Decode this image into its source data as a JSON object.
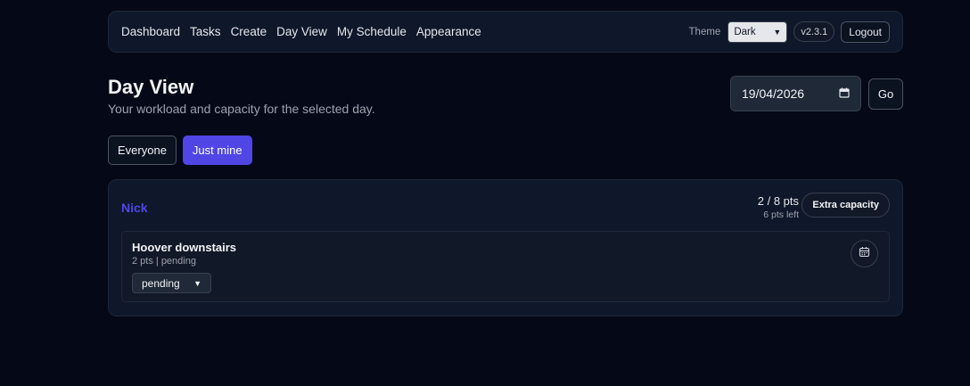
{
  "nav": {
    "links": [
      "Dashboard",
      "Tasks",
      "Create",
      "Day View",
      "My Schedule",
      "Appearance"
    ],
    "theme_label": "Theme",
    "theme_value": "Dark",
    "version": "v2.3.1",
    "logout": "Logout"
  },
  "header": {
    "title": "Day View",
    "subtitle": "Your workload and capacity for the selected day.",
    "date_value": "19/04/2026",
    "go_label": "Go"
  },
  "filters": {
    "everyone": "Everyone",
    "just_mine": "Just mine",
    "active": "just_mine"
  },
  "person": {
    "name": "Nick",
    "capacity_points": "2 / 8 pts",
    "capacity_left": "6 pts left",
    "extra_capacity_label": "Extra capacity"
  },
  "task": {
    "title": "Hoover downstairs",
    "meta": "2 pts | pending",
    "status_value": "pending"
  },
  "colors": {
    "accent": "#4f46e5",
    "background": "#050816",
    "card": "#0f172a"
  }
}
